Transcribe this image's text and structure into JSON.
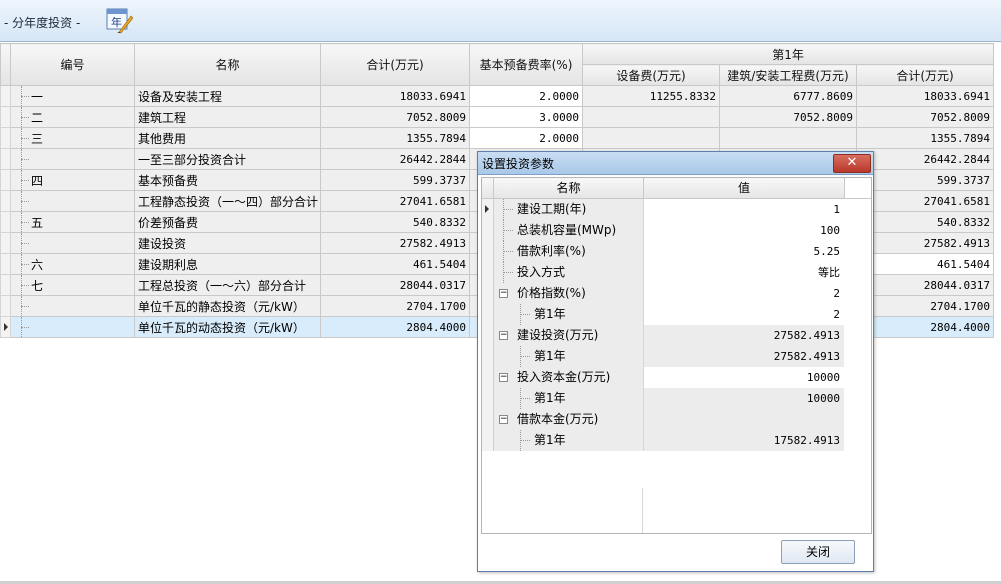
{
  "header": {
    "title": "- 分年度投资 -",
    "icon_label": "年"
  },
  "grid": {
    "columns": {
      "code": "编号",
      "name": "名称",
      "total": "合计(万元)",
      "rate": "基本预备费率(%)",
      "year_group": "第1年",
      "equip": "设备费(万元)",
      "build": "建筑/安装工程费(万元)",
      "year_total": "合计(万元)"
    },
    "rows": [
      {
        "code": "一",
        "name": "设备及安装工程",
        "total": "18033.6941",
        "rate": "2.0000",
        "equip": "11255.8332",
        "build": "6777.8609",
        "year_total": "18033.6941"
      },
      {
        "code": "二",
        "name": "建筑工程",
        "total": "7052.8009",
        "rate": "3.0000",
        "equip": "",
        "build": "7052.8009",
        "year_total": "7052.8009"
      },
      {
        "code": "三",
        "name": "其他费用",
        "total": "1355.7894",
        "rate": "2.0000",
        "equip": "",
        "build": "",
        "year_total": "1355.7894"
      },
      {
        "code": "",
        "name": "一至三部分投资合计",
        "total": "26442.2844",
        "rate": "",
        "equip": "",
        "build": "",
        "year_total": "26442.2844"
      },
      {
        "code": "四",
        "name": "基本预备费",
        "total": "599.3737",
        "rate": "",
        "equip": "",
        "build": "",
        "year_total": "599.3737"
      },
      {
        "code": "",
        "name": "工程静态投资（一～四）部分合计",
        "total": "27041.6581",
        "rate": "",
        "equip": "",
        "build": "",
        "year_total": "27041.6581"
      },
      {
        "code": "五",
        "name": "价差预备费",
        "total": "540.8332",
        "rate": "",
        "equip": "",
        "build": "",
        "year_total": "540.8332"
      },
      {
        "code": "",
        "name": "建设投资",
        "total": "27582.4913",
        "rate": "",
        "equip": "",
        "build": "",
        "year_total": "27582.4913"
      },
      {
        "code": "六",
        "name": "建设期利息",
        "total": "461.5404",
        "rate": "",
        "equip": "",
        "build": "",
        "year_total": "461.5404"
      },
      {
        "code": "七",
        "name": "工程总投资（一～六）部分合计",
        "total": "28044.0317",
        "rate": "",
        "equip": "",
        "build": "",
        "year_total": "28044.0317"
      },
      {
        "code": "",
        "name": "单位千瓦的静态投资（元/kW）",
        "total": "2704.1700",
        "rate": "",
        "equip": "",
        "build": "",
        "year_total": "2704.1700"
      },
      {
        "code": "",
        "name": "单位千瓦的动态投资（元/kW）",
        "total": "2804.4000",
        "rate": "",
        "equip": "",
        "build": "",
        "year_total": "2804.4000"
      }
    ]
  },
  "dialog": {
    "title": "设置投资参数",
    "close_glyph": "✕",
    "col_name": "名称",
    "col_value": "值",
    "rows": [
      {
        "label": "建设工期(年)",
        "value": "1"
      },
      {
        "label": "总装机容量(MWp)",
        "value": "100"
      },
      {
        "label": "借款利率(%)",
        "value": "5.25"
      },
      {
        "label": "投入方式",
        "value": "等比"
      },
      {
        "label": "价格指数(%)",
        "value": "2"
      },
      {
        "label": "第1年",
        "value": "2"
      },
      {
        "label": "建设投资(万元)",
        "value": "27582.4913"
      },
      {
        "label": "第1年",
        "value": "27582.4913"
      },
      {
        "label": "投入资本金(万元)",
        "value": "10000"
      },
      {
        "label": "第1年",
        "value": "10000"
      },
      {
        "label": "借款本金(万元)",
        "value": ""
      },
      {
        "label": "第1年",
        "value": "17582.4913"
      }
    ],
    "close_button": "关闭"
  }
}
